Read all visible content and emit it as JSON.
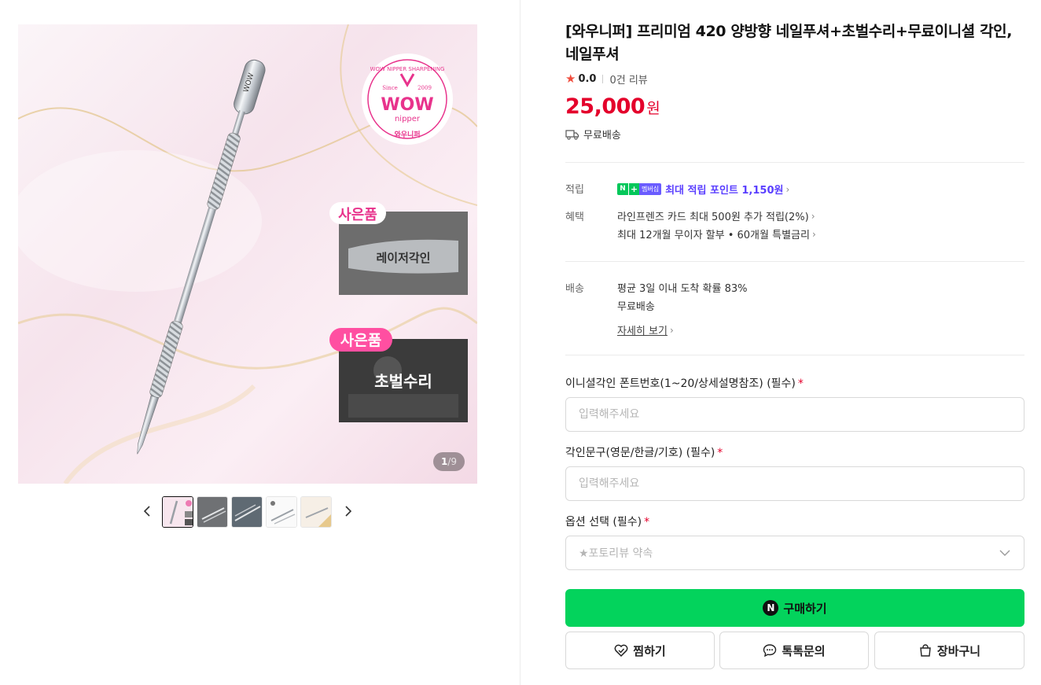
{
  "product": {
    "title": "[와우니퍼] 프리미엄 420 양방향 네일푸셔+초벌수리+무료이니셜 각인, 네일푸셔",
    "rating": "0.0",
    "review_count": "0건 리뷰",
    "price": "25,000",
    "currency": "원",
    "shipping_badge": "무료배송"
  },
  "gallery": {
    "current_page": "1",
    "total_pages": "/9",
    "image_texts": {
      "brand_ring": "WOW NIPPER SHARPENING",
      "brand_since": "Since",
      "brand_year": "2009",
      "brand_wow": "WOW",
      "brand_nipper": "nipper",
      "brand_korean": "와우니퍼",
      "gift_label_1": "사은품",
      "gift_caption_1": "레이저각인",
      "gift_label_2": "사은품",
      "gift_caption_2": "초벌수리"
    },
    "thumbnail_count": 5
  },
  "benefits": {
    "points_label": "적립",
    "points_badge_n": "N",
    "points_badge_plus": "+",
    "points_badge_member": "멤버십",
    "points_text": "최대 적립 포인트 1,150원",
    "perks_label": "혜택",
    "perk_1": "라인프렌즈 카드 최대 500원 추가 적립(2%)",
    "perk_2": "최대 12개월 무이자 할부 • 60개월 특별금리"
  },
  "delivery": {
    "label": "배송",
    "estimate": "평균 3일 이내 도착 확률 83%",
    "fee": "무료배송",
    "detail_link": "자세히 보기"
  },
  "form": {
    "field_1_label": "이니셜각인 폰트번호(1~20/상세설명참조) (필수)",
    "field_1_placeholder": "입력해주세요",
    "field_2_label": "각인문구(영문/한글/기호) (필수)",
    "field_2_placeholder": "입력해주세요",
    "option_label": "옵션 선택 (필수)",
    "option_selected": "★포토리뷰 약속",
    "required_mark": "*"
  },
  "actions": {
    "buy_icon": "N",
    "buy_label": "구매하기",
    "wish_label": "찜하기",
    "talk_label": "톡톡문의",
    "cart_label": "장바구니"
  },
  "colors": {
    "price": "#e4002b",
    "buy_button": "#03d35c",
    "points": "#5a3fff",
    "star": "#f04e3e"
  }
}
